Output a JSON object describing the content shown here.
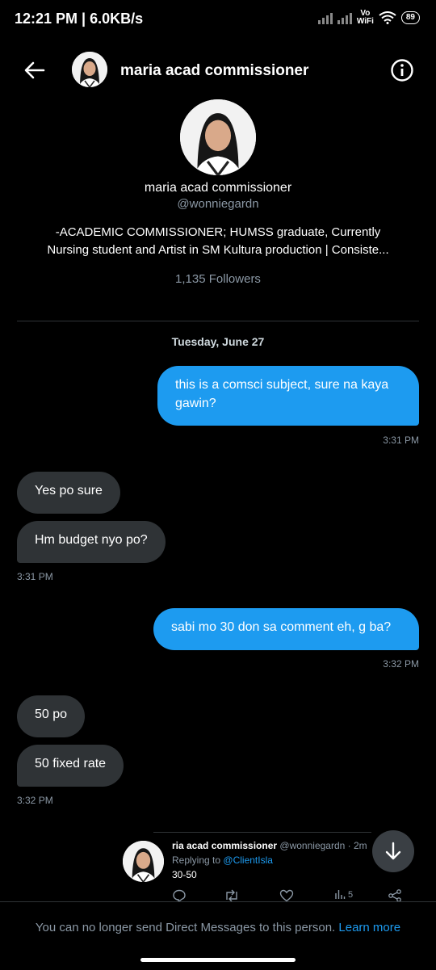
{
  "status": {
    "time": "12:21 PM | 6.0KB/s",
    "vowifi_top": "Vo",
    "vowifi_bottom": "WiFi",
    "battery": "89"
  },
  "header": {
    "name": "maria acad commissioner"
  },
  "profile": {
    "name": "maria acad commissioner",
    "handle": "@wonniegardn",
    "bio_line1": "-ACADEMIC COMMISSIONER; HUMSS graduate, Currently",
    "bio_line2": "Nursing student and Artist in SM Kultura production | Consiste...",
    "followers": "1,135 Followers"
  },
  "conversation": {
    "date": "Tuesday, June 27",
    "messages": [
      {
        "text": "this is a comsci subject, sure na kaya gawin?",
        "time": "3:31 PM"
      },
      {
        "text": "Yes po sure"
      },
      {
        "text": "Hm budget nyo po?",
        "time": "3:31 PM"
      },
      {
        "text": "sabi mo 30 don sa comment eh, g ba?",
        "time": "3:32 PM"
      },
      {
        "text": "50 po"
      },
      {
        "text": "50 fixed rate",
        "time": "3:32 PM"
      }
    ]
  },
  "quoted_tweet": {
    "name": "ria acad commissioner",
    "handle": "@wonniegardn",
    "age": "· 2m",
    "replying_label": "Replying to",
    "replying_to": "@ClientIsla",
    "text": "30-50",
    "views": "5"
  },
  "footer": {
    "notice": "You can no longer send Direct Messages to this person.",
    "learn_more": "Learn more"
  }
}
